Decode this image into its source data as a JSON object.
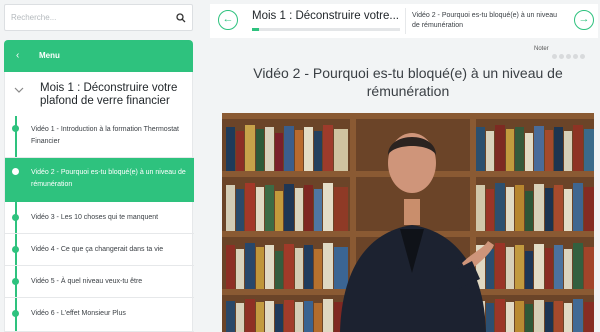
{
  "search": {
    "placeholder": "Recherche..."
  },
  "menu": {
    "back_label": "‹",
    "title": "Menu"
  },
  "module": {
    "title": "Mois 1 : Déconstruire votre plafond de verre financier"
  },
  "lessons": [
    {
      "label": "Vidéo 1 - Introduction à la formation Thermostat Financier",
      "active": false
    },
    {
      "label": "Vidéo 2 - Pourquoi es-tu bloqué(e) à un niveau de rémunération",
      "active": true
    },
    {
      "label": "Vidéo 3 - Les 10 choses qui te manquent",
      "active": false
    },
    {
      "label": "Vidéo 4 - Ce que ça changerait dans ta vie",
      "active": false
    },
    {
      "label": "Vidéo 5 - À quel niveau veux-tu être",
      "active": false
    },
    {
      "label": "Vidéo 6 - L'effet Monsieur Plus",
      "active": false
    }
  ],
  "topbar": {
    "prev_icon": "←",
    "next_icon": "→",
    "current_title": "Mois 1 : Déconstruire votre...",
    "progress": 0.05,
    "next_lesson": "Vidéo 2 - Pourquoi es-tu bloqué(e) à un niveau de rémunération"
  },
  "rating": {
    "label": "Noter",
    "stars": 5,
    "value": 0
  },
  "video": {
    "title": "Vidéo 2 - Pourquoi es-tu bloqué(e) à un niveau de rémunération"
  },
  "colors": {
    "accent": "#2ec27e"
  }
}
